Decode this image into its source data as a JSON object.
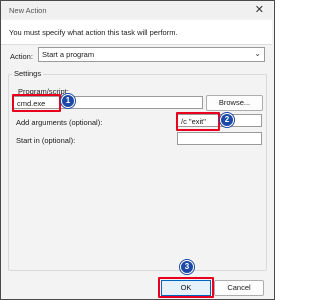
{
  "window": {
    "title": "New Action",
    "close_glyph": "✕"
  },
  "banner": {
    "message": "You must specify what action this task will perform."
  },
  "action": {
    "label": "Action:",
    "selected": "Start a program",
    "dropdown_glyph": "⌄"
  },
  "settings": {
    "group_label": "Settings",
    "program_label": "Program/script:",
    "program_value": "cmd.exe",
    "browse_label": "Browse...",
    "arguments_label": "Add arguments (optional):",
    "arguments_value": "/c \"exit\"",
    "start_in_label": "Start in (optional):",
    "start_in_value": ""
  },
  "buttons": {
    "ok": "OK",
    "cancel": "Cancel"
  },
  "annotations": {
    "badge_1": "1",
    "badge_2": "2",
    "badge_3": "3",
    "highlight_color": "#e8001c",
    "badge_color": "#1d49a6"
  }
}
